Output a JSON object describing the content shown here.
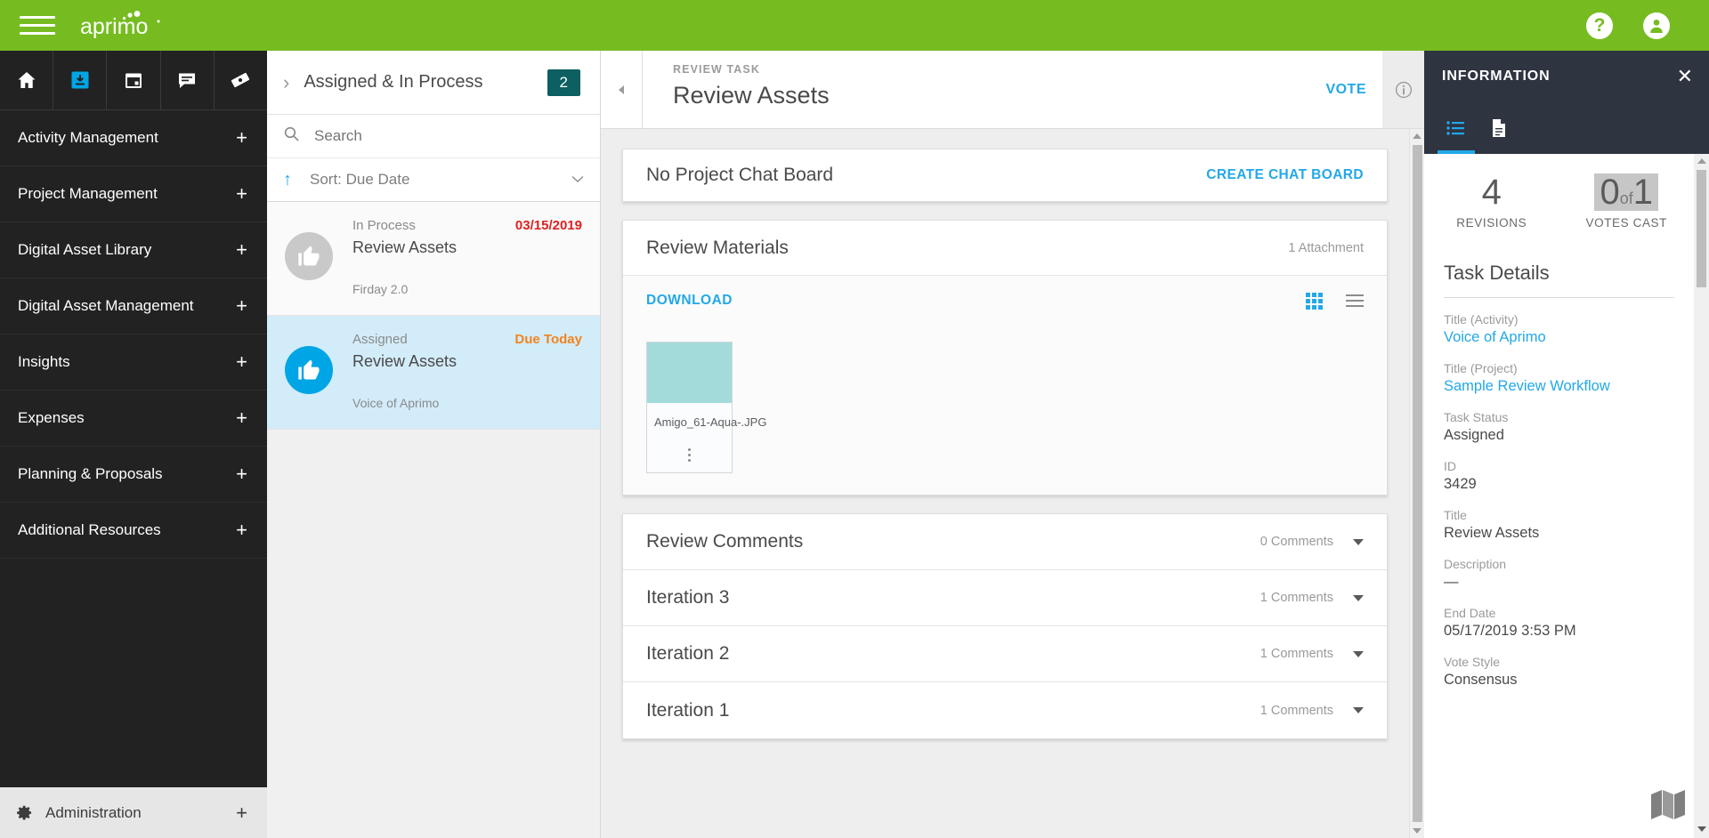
{
  "topbar": {
    "menu_icon": "hamburger-icon",
    "brand": "aprimo",
    "help_icon": "help-icon",
    "help_label": "?",
    "account_icon": "account-icon"
  },
  "leftnav": {
    "icons": [
      {
        "name": "home-icon",
        "active": false
      },
      {
        "name": "inbox-download-icon",
        "active": true
      },
      {
        "name": "calendar-icon",
        "active": false
      },
      {
        "name": "chat-icon",
        "active": false
      },
      {
        "name": "ticket-icon",
        "active": false
      }
    ],
    "items": [
      {
        "label": "Activity Management",
        "expand": "+"
      },
      {
        "label": "Project Management",
        "expand": "+"
      },
      {
        "label": "Digital Asset Library",
        "expand": "+"
      },
      {
        "label": "Digital Asset Management",
        "expand": "+"
      },
      {
        "label": "Insights",
        "expand": "+"
      },
      {
        "label": "Expenses",
        "expand": "+"
      },
      {
        "label": "Planning & Proposals",
        "expand": "+"
      },
      {
        "label": "Additional Resources",
        "expand": "+"
      }
    ],
    "administration": {
      "label": "Administration",
      "expand": "+",
      "icon": "gear-icon"
    }
  },
  "tasklist": {
    "header": {
      "chevron": "›",
      "title": "Assigned & In Process",
      "badge": "2"
    },
    "search": {
      "placeholder": "Search",
      "value": "",
      "icon": "search-icon"
    },
    "sort": {
      "label": "Sort: Due Date",
      "arrow": "↑",
      "chevron": "⌄"
    },
    "items": [
      {
        "status": "In Process",
        "due": "03/15/2019",
        "due_tone": "red",
        "name": "Review Assets",
        "subtitle": "Firday 2.0",
        "icon": "thumbs-up-icon",
        "selected": false
      },
      {
        "status": "Assigned",
        "due": "Due Today",
        "due_tone": "orange",
        "name": "Review Assets",
        "subtitle": "Voice of Aprimo",
        "icon": "thumbs-up-icon",
        "selected": true
      }
    ]
  },
  "main": {
    "header": {
      "collapse_icon": "collapse-left-icon",
      "kicker": "REVIEW TASK",
      "title": "Review Assets",
      "vote_label": "VOTE",
      "info_icon": "info-icon"
    },
    "chat_board": {
      "title": "No Project Chat Board",
      "action_label": "CREATE CHAT BOARD"
    },
    "review_materials": {
      "title": "Review Materials",
      "meta": "1 Attachment",
      "download_label": "DOWNLOAD",
      "grid_view_icon": "grid-view-icon",
      "list_view_icon": "list-view-icon",
      "assets": [
        {
          "filename": "Amigo_61-Aqua-.JPG",
          "swatch_color": "#a3dbdb",
          "menu_icon": "kebab-menu-icon"
        }
      ]
    },
    "accordion": [
      {
        "title": "Review Comments",
        "count": "0 Comments"
      },
      {
        "title": "Iteration 3",
        "count": "1 Comments"
      },
      {
        "title": "Iteration 2",
        "count": "1 Comments"
      },
      {
        "title": "Iteration 1",
        "count": "1 Comments"
      }
    ]
  },
  "infopanel": {
    "title": "INFORMATION",
    "close_icon": "close-icon",
    "tabs": [
      {
        "name": "details-list-tab",
        "icon": "list-icon",
        "active": true
      },
      {
        "name": "document-tab",
        "icon": "document-icon",
        "active": false
      }
    ],
    "stats": [
      {
        "value": "4",
        "label": "REVISIONS",
        "highlight": false
      },
      {
        "value": "0",
        "mid": "of",
        "value2": "1",
        "label": "VOTES CAST",
        "highlight": true
      }
    ],
    "details_heading": "Task Details",
    "fields": [
      {
        "label": "Title (Activity)",
        "value": "Voice of Aprimo",
        "is_link": true
      },
      {
        "label": "Title (Project)",
        "value": "Sample Review Workflow",
        "is_link": true
      },
      {
        "label": "Task Status",
        "value": "Assigned",
        "is_link": false
      },
      {
        "label": "ID",
        "value": "3429",
        "is_link": false
      },
      {
        "label": "Title",
        "value": "Review Assets",
        "is_link": false
      },
      {
        "label": "Description",
        "value": "—",
        "is_link": false
      },
      {
        "label": "End Date",
        "value": "05/17/2019 3:53 PM",
        "is_link": false
      },
      {
        "label": "Vote Style",
        "value": "Consensus",
        "is_link": false
      }
    ],
    "map_icon": "map-icon"
  },
  "colors": {
    "brand_green": "#76bc21",
    "accent_blue": "#23a8e8",
    "badge_teal": "#0d5f61",
    "nav_dark": "#222222",
    "panel_dark": "#2e3440",
    "due_red": "#e02020",
    "due_orange": "#f08420",
    "selected_row": "#d3ecf9"
  }
}
